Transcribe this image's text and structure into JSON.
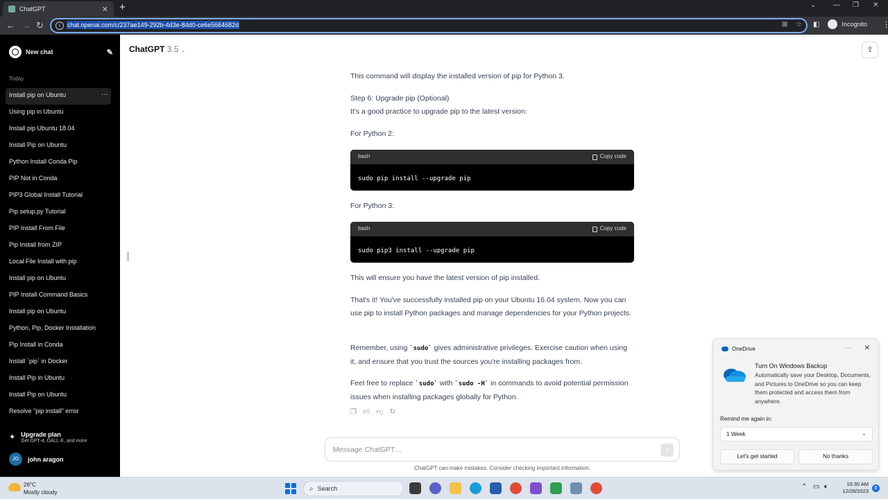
{
  "browser": {
    "tab_title": "ChatGPT",
    "url": "chat.openai.com/c/237ae149-292b-4d3e-84d0-ce6e5664682d",
    "profile_label": "Incognito"
  },
  "sidebar": {
    "new_chat_label": "New chat",
    "section_label": "Today",
    "items": [
      {
        "label": "Install pip on Ubuntu"
      },
      {
        "label": "Using pip in Ubuntu"
      },
      {
        "label": "Install pip Ubuntu 18.04"
      },
      {
        "label": "Install Pip on Ubuntu"
      },
      {
        "label": "Python Install Conda Pip"
      },
      {
        "label": "PIP Not in Conda"
      },
      {
        "label": "PIP3 Global Install Tutorial"
      },
      {
        "label": "Pip setup.py Tutorial"
      },
      {
        "label": "PIP Install From File"
      },
      {
        "label": "Pip Install from ZIP"
      },
      {
        "label": "Local File Install with pip"
      },
      {
        "label": "Install pip on Ubuntu"
      },
      {
        "label": "PIP Install Command Basics"
      },
      {
        "label": "Install pip on Ubuntu"
      },
      {
        "label": "Python, Pip, Docker Installation"
      },
      {
        "label": "Pip Install in Conda"
      },
      {
        "label": "Install `pip` in Docker"
      },
      {
        "label": "Install Pip in Ubuntu"
      },
      {
        "label": "Install Pip on Ubuntu"
      },
      {
        "label": "Resolve \"pip install\" error"
      }
    ],
    "upgrade_title": "Upgrade plan",
    "upgrade_subtitle": "Get GPT-4, DALL·E, and more",
    "user_initials": "JO",
    "user_name": "john aragon"
  },
  "header": {
    "model_name": "ChatGPT",
    "model_version": "3.5"
  },
  "conversation": {
    "p1": "This command will display the installed version of pip for Python 3.",
    "step6_title": "Step 6: Upgrade pip (Optional)",
    "step6_body": "It's a good practice to upgrade pip to the latest version:",
    "py2_label": "For Python 2:",
    "code1": {
      "lang": "bash",
      "copy_label": "Copy code",
      "text": "sudo pip install --upgrade pip"
    },
    "py3_label": "For Python 3:",
    "code2": {
      "lang": "bash",
      "copy_label": "Copy code",
      "text": "sudo pip3 install --upgrade pip"
    },
    "ensure": "This will ensure you have the latest version of pip installed.",
    "thats_it": "That's it! You've successfully installed pip on your Ubuntu 16.04 system. Now you can use pip to install Python packages and manage dependencies for your Python projects.",
    "remember_a": "Remember, using ",
    "remember_code": "`sudo`",
    "remember_b": " gives administrative privileges. Exercise caution when using it, and ensure that you trust the sources you're installing packages from.",
    "feel_a": "Feel free to replace ",
    "feel_code1": "`sudo`",
    "feel_b": " with ",
    "feel_code2": "`sudo -H`",
    "feel_c": " in commands to avoid potential permission issues when installing packages globally for Python."
  },
  "composer": {
    "placeholder": "Message ChatGPT…",
    "disclaimer": "ChatGPT can make mistakes. Consider checking important information."
  },
  "toast": {
    "app_name": "OneDrive",
    "title": "Turn On Windows Backup",
    "body": "Automatically save your Desktop, Documents, and Pictures to OneDrive so you can keep them protected and access them from anywhere.",
    "remind_label": "Remind me again in:",
    "remind_value": "1 Week",
    "primary_button": "Let's get started",
    "secondary_button": "No thanks"
  },
  "taskbar": {
    "temperature": "26°C",
    "weather": "Mostly cloudy",
    "search_label": "Search",
    "time": "10:30 AM",
    "date": "12/28/2023",
    "notification_count": "6"
  }
}
